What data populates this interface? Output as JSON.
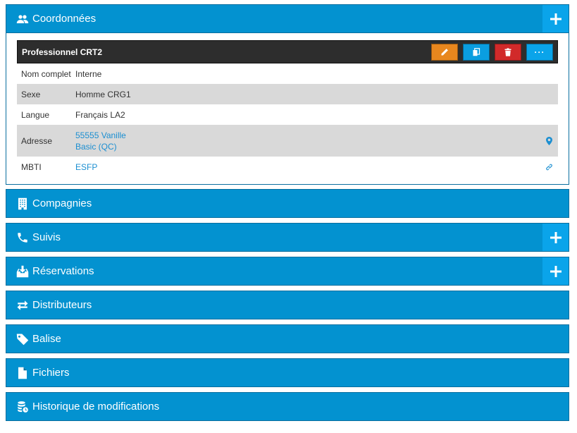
{
  "sections": {
    "coordonnees": {
      "title": "Coordonnées",
      "icon": "users-icon"
    },
    "compagnies": {
      "title": "Compagnies",
      "icon": "building-icon"
    },
    "suivis": {
      "title": "Suivis",
      "icon": "phone-icon"
    },
    "reservations": {
      "title": "Réservations",
      "icon": "inbox-download-icon"
    },
    "distributeurs": {
      "title": "Distributeurs",
      "icon": "exchange-arrows-icon"
    },
    "balise": {
      "title": "Balise",
      "icon": "tag-icon"
    },
    "fichiers": {
      "title": "Fichiers",
      "icon": "file-icon"
    },
    "historique": {
      "title": "Historique de modifications",
      "icon": "history-icon"
    }
  },
  "record": {
    "title": "Professionnel CRT2",
    "more_label": "···",
    "fields": [
      {
        "label": "Nom complet",
        "value": "Interne"
      },
      {
        "label": "Sexe",
        "value": "Homme CRG1"
      },
      {
        "label": "Langue",
        "value": "Français LA2"
      },
      {
        "label": "Adresse",
        "value_line1": "55555 Vanille",
        "value_line2": "Basic (QC)",
        "icon": "map-marker-icon"
      },
      {
        "label": "MBTI",
        "value": "ESFP",
        "icon": "link-icon"
      }
    ]
  },
  "colors": {
    "header_blue": "#0392d0",
    "plus_blue": "#0aa4ea",
    "edit_orange": "#e8871e",
    "copy_blue": "#0a9ee0",
    "delete_red": "#d12a2a",
    "link_blue": "#1c8fd1",
    "record_dark": "#2d2d2d"
  }
}
